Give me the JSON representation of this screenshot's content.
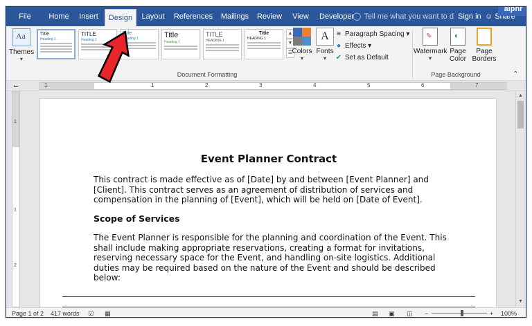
{
  "tabs": [
    {
      "id": "file",
      "label": "File"
    },
    {
      "id": "home",
      "label": "Home"
    },
    {
      "id": "insert",
      "label": "Insert"
    },
    {
      "id": "design",
      "label": "Design"
    },
    {
      "id": "layout",
      "label": "Layout"
    },
    {
      "id": "references",
      "label": "References"
    },
    {
      "id": "mailings",
      "label": "Mailings"
    },
    {
      "id": "review",
      "label": "Review"
    },
    {
      "id": "view",
      "label": "View"
    },
    {
      "id": "developer",
      "label": "Developer"
    }
  ],
  "tell_me": {
    "text": "Tell me what you want to d"
  },
  "signin": "Sign in",
  "share": "Share",
  "watermark_brand": "alphr",
  "ribbon": {
    "themes": "Themes",
    "style_thumbs": [
      {
        "title": "Title",
        "heading": "Heading 1"
      },
      {
        "title": "TITLE",
        "heading": "Heading 1"
      },
      {
        "title": "Title",
        "heading": "Heading 1"
      },
      {
        "title": "Title",
        "heading": "Heading 1"
      },
      {
        "title": "TITLE",
        "heading": "HEADING 1"
      },
      {
        "title": "Title",
        "heading": "HEADING 1"
      }
    ],
    "colors": "Colors",
    "fonts": "Fonts",
    "font_glyph": "A",
    "paragraph_spacing": "Paragraph Spacing",
    "effects": "Effects",
    "set_as_default": "Set as Default",
    "watermark": "Watermark",
    "page_color": "Page Color",
    "page_borders": "Page Borders",
    "group_document_formatting": "Document Formatting",
    "group_page_background": "Page Background"
  },
  "ruler": {
    "numbers": [
      "1",
      "1",
      "2",
      "3",
      "4",
      "5",
      "6",
      "7"
    ]
  },
  "vruler": {
    "numbers": [
      "1",
      "1",
      "2"
    ]
  },
  "document": {
    "title": "Event Planner Contract",
    "intro": "This contract is made effective as of [Date] by and between [Event Planner] and [Client]. This contract serves as an agreement of distribution of services and compensation in the planning of [Event], which will be held on [Date of Event].",
    "section_heading": "Scope of Services",
    "scope": "The Event Planner is responsible for the planning and coordination of the Event. This shall include making appropriate reservations, creating a format for invitations, reserving necessary space for the Event, and handling on-site logistics. Additional duties may be required based on the nature of the Event and should be described below:"
  },
  "status": {
    "page": "Page 1 of 2",
    "words": "417 words",
    "zoom": "100%",
    "zoom_level": 1.0
  },
  "colors": {
    "accent": "#2b579a",
    "arrow": "#e8262a",
    "ribbon_bg": "#f3f3f3"
  }
}
